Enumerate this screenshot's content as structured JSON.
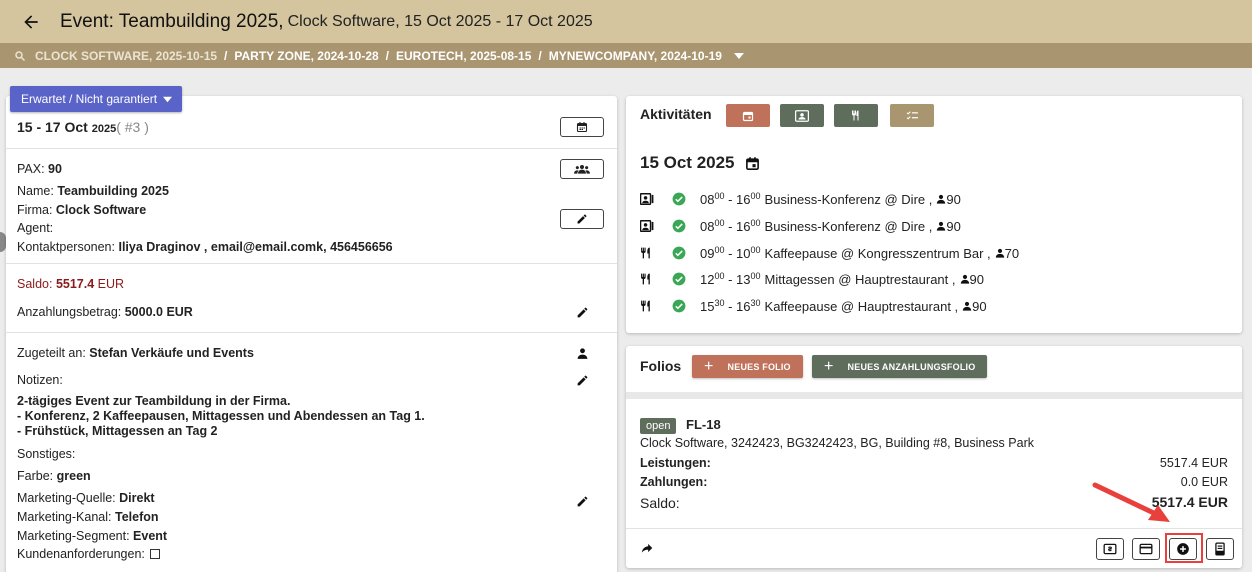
{
  "header": {
    "title": "Event: Teambuilding 2025,",
    "subtitle": "Clock Software, 15 Oct 2025 - 17 Oct 2025"
  },
  "breadcrumbs": [
    "CLOCK SOFTWARE, 2025-10-15",
    "PARTY ZONE, 2024-10-28",
    "EUROTECH, 2025-08-15",
    "MYNEWCOMPANY, 2024-10-19"
  ],
  "breadcrumb_separator": "/",
  "status": "Erwartet / Nicht garantiert",
  "event": {
    "date_range": "15 - 17 Oct",
    "year": "2025",
    "number": "( #3 )",
    "pax_label": "PAX:",
    "pax": "90",
    "name_label": "Name:",
    "name": "Teambuilding 2025",
    "company_label": "Firma:",
    "company": "Clock Software",
    "agent_label": "Agent:",
    "contacts_label": "Kontaktpersonen:",
    "contacts": "Iliya Draginov , email@email.comk, 456456656",
    "balance_label": "Saldo:",
    "balance": "5517.4",
    "balance_currency": "EUR",
    "deposit_label": "Anzahlungsbetrag:",
    "deposit": "5000.0 EUR",
    "assigned_label": "Zugeteilt an:",
    "assigned": "Stefan  Verkäufe und Events",
    "notes_label": "Notizen:",
    "notes": [
      "2-tägiges Event zur Teambildung in der Firma.",
      "- Konferenz, 2 Kaffeepausen, Mittagessen und Abendessen an Tag 1.",
      "- Frühstück, Mittagessen an Tag 2"
    ],
    "other_label": "Sonstiges:",
    "color_label": "Farbe:",
    "color": "green",
    "mkt_source_label": "Marketing-Quelle:",
    "mkt_source": "Direkt",
    "mkt_channel_label": "Marketing-Kanal:",
    "mkt_channel": "Telefon",
    "mkt_segment_label": "Marketing-Segment:",
    "mkt_segment": "Event",
    "requests_label": "Kundenanforderungen:"
  },
  "activities": {
    "title": "Aktivitäten",
    "date": "15 Oct 2025",
    "buttons": [
      {
        "icon": "calendar-icon",
        "color": "#c0715a"
      },
      {
        "icon": "contact-card-icon",
        "color": "#5f6e5c"
      },
      {
        "icon": "restaurant-icon",
        "color": "#5f6e5c"
      },
      {
        "icon": "checklist-icon",
        "color": "#a99671"
      }
    ],
    "rows": [
      {
        "type": "meeting",
        "start_h": "08",
        "start_m": "00",
        "end_h": "16",
        "end_m": "00",
        "text": "Business-Konferenz @ Dire ,",
        "pax": "90"
      },
      {
        "type": "meeting",
        "start_h": "08",
        "start_m": "00",
        "end_h": "16",
        "end_m": "00",
        "text": "Business-Konferenz @ Dire ,",
        "pax": "90"
      },
      {
        "type": "food",
        "start_h": "09",
        "start_m": "00",
        "end_h": "10",
        "end_m": "00",
        "text": "Kaffeepause @ Kongresszentrum Bar ,",
        "pax": "70"
      },
      {
        "type": "food",
        "start_h": "12",
        "start_m": "00",
        "end_h": "13",
        "end_m": "00",
        "text": "Mittagessen @ Hauptrestaurant ,",
        "pax": "90"
      },
      {
        "type": "food",
        "start_h": "15",
        "start_m": "30",
        "end_h": "16",
        "end_m": "30",
        "text": "Kaffeepause @ Hauptrestaurant ,",
        "pax": "90"
      }
    ]
  },
  "folios": {
    "title": "Folios",
    "new_folio": "NEUES FOLIO",
    "new_deposit_folio": "NEUES ANZAHLUNGSFOLIO",
    "status": "open",
    "number": "FL-18",
    "address": "Clock Software, 3242423, BG3242423, BG, Building #8, Business Park",
    "services_label": "Leistungen:",
    "services": "5517.4 EUR",
    "payments_label": "Zahlungen:",
    "payments": "0.0 EUR",
    "balance_label": "Saldo:",
    "balance": "5517.4 EUR"
  },
  "colors": {
    "topbar": "#d4c59f",
    "crumbbar": "#a99671",
    "status_chip": "#5a63c8",
    "new_folio": "#c0715a",
    "new_deposit_folio": "#5f6e5c",
    "check": "#3aa757",
    "balance_red": "#8b1a1a",
    "highlight": "#e8403a"
  }
}
